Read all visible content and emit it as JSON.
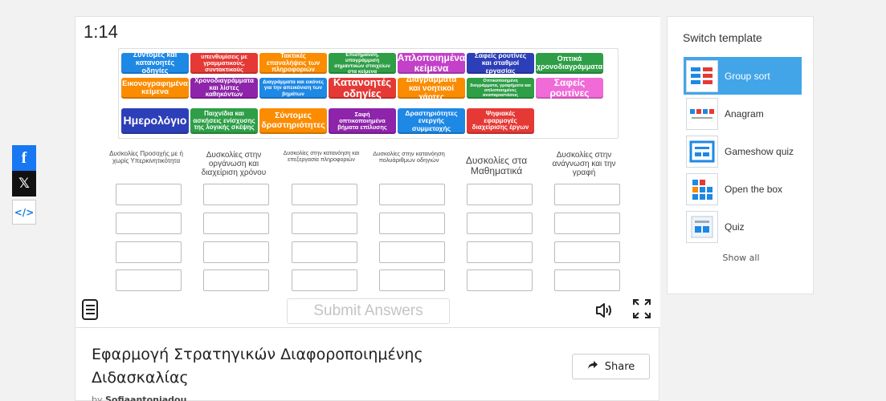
{
  "social": {
    "facebook": "f",
    "twitter": "𝕏",
    "embed": "</>"
  },
  "timer": "1:14",
  "tiles": [
    {
      "text": "Σύντομες και κατανοητές οδηγίες",
      "color": "#1e88e5"
    },
    {
      "text": "Οπτικές υπενθυμίσεις με γραμματικούς, συντακτικούς κανόνες",
      "color": "#e53935"
    },
    {
      "text": "Τακτικές επαναλήψεις των πληροφοριών",
      "color": "#fb8c00"
    },
    {
      "text": "Επισήμανση, υπογράμμιση σημαντικών στοιχείων στα κείμενα",
      "color": "#2e9e47"
    },
    {
      "text": "Απλοποιημένα κείμενα",
      "color": "#c340c9"
    },
    {
      "text": "Σαφείς ρουτίνες και σταθμοί εργασίας",
      "color": "#2c3fb8"
    },
    {
      "text": "Οπτικά χρονοδιαγράμματα",
      "color": "#2e9e47"
    },
    {
      "text": "Εικονογραφημένα κείμενα",
      "color": "#fb8c00"
    },
    {
      "text": "Χρονοδιαγράμματα και λίστες καθηκόντων",
      "color": "#8e24aa"
    },
    {
      "text": "Διαγράμματα και εικόνες για την απεικόνιση των βημάτων",
      "color": "#1e88e5"
    },
    {
      "text": "Κατανοητές οδηγίες",
      "color": "#e53935"
    },
    {
      "text": "Διαγράμματα και νοητικοί χάρτες",
      "color": "#fb8c00"
    },
    {
      "text": "Οπτικοποιημένη διαγράμματα, γραφήματα και απλοποιημένες αναπαραστάσεις",
      "color": "#2e9e47"
    },
    {
      "text": "Σαφείς ρουτίνες",
      "color": "#f06bd8"
    },
    {
      "text": "Ημερολόγιο",
      "color": "#2c3fb8"
    },
    {
      "text": "Παιχνίδια και ασκήσεις ενίσχυσης της λογικής σκέψης",
      "color": "#2e9e47"
    },
    {
      "text": "Σύντομες δραστηριότητες",
      "color": "#fb8c00"
    },
    {
      "text": "Σαφή οπτικοποιημένα βήματα επίλυσης",
      "color": "#8e24aa"
    },
    {
      "text": "Δραστηριότητες ενεργής συμμετοχής",
      "color": "#1e88e5"
    },
    {
      "text": "Ψηφιακές εφαρμογές διαχείρισης έργων",
      "color": "#e53935"
    }
  ],
  "groups": [
    "Δυσκολίες Προσοχής με ή χωρίς Υπερκινητικότητα",
    "Δυσκολίες στην οργάνωση και διαχείριση χρόνου",
    "Δυσκολίες στην κατανόηση και επεξεργασία πληροφοριών",
    "Δυσκολίες στην κατανόηση πολυάριθμων οδηγιών",
    "Δυσκολίες στα Μαθηματικά",
    "Δυσκολίες στην ανάγνωση και την γραφή"
  ],
  "submit_label": "Submit Answers",
  "title": "Εφαρμογή Στρατηγικών Διαφοροποιημένης Διδασκαλίας",
  "share_label": "Share",
  "byline": {
    "prefix": "by",
    "author": "Sofiaantoniadou"
  },
  "sidebar": {
    "title": "Switch template",
    "templates": [
      "Group sort",
      "Anagram",
      "Gameshow quiz",
      "Open the box",
      "Quiz"
    ],
    "show_all": "Show all"
  },
  "colors": {
    "accent": "#42a5e8"
  }
}
